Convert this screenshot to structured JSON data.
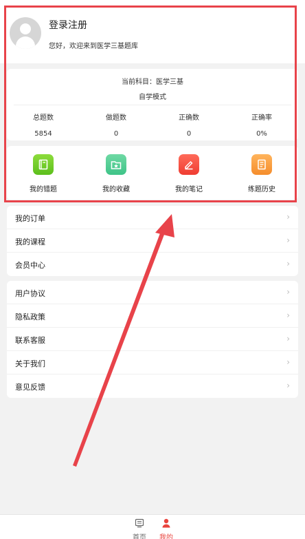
{
  "profile": {
    "login_label": "登录注册",
    "welcome_text": "您好，欢迎来到医学三基题库"
  },
  "stats": {
    "subject_label": "当前科目：医学三基",
    "mode_label": "自学模式",
    "items": [
      {
        "label": "总题数",
        "value": "5854"
      },
      {
        "label": "做题数",
        "value": "0"
      },
      {
        "label": "正确数",
        "value": "0"
      },
      {
        "label": "正确率",
        "value": "0%"
      }
    ]
  },
  "tools": [
    {
      "label": "我的错题",
      "icon": "notebook-icon",
      "color": "#6cc92a"
    },
    {
      "label": "我的收藏",
      "icon": "star-folder-icon",
      "color": "#4fcb92"
    },
    {
      "label": "我的笔记",
      "icon": "pencil-icon",
      "color": "#f24a3d"
    },
    {
      "label": "练题历史",
      "icon": "document-icon",
      "color": "#f7a042"
    }
  ],
  "menu1": [
    {
      "label": "我的订单"
    },
    {
      "label": "我的课程"
    },
    {
      "label": "会员中心"
    }
  ],
  "menu2": [
    {
      "label": "用户协议"
    },
    {
      "label": "隐私政策"
    },
    {
      "label": "联系客服"
    },
    {
      "label": "关于我们"
    },
    {
      "label": "意见反馈"
    }
  ],
  "tabbar": {
    "home_label": "首页",
    "me_label": "我的",
    "active_color": "#e9443d"
  },
  "annotation": {
    "color": "#e8434a"
  }
}
